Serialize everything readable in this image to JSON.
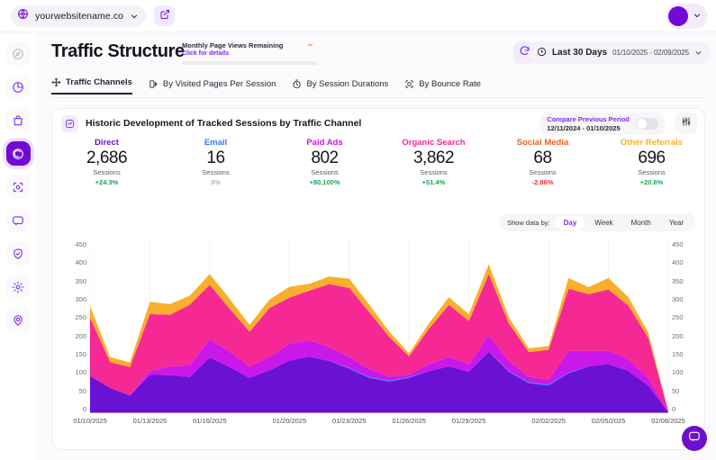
{
  "topbar": {
    "site_name": "yourwebsitename.co",
    "globe_icon": "globe-icon",
    "chevron_icon": "chevron-down-icon",
    "share_icon": "external-link-icon",
    "avatar_icon": "avatar",
    "avatar_chevron": "chevron-down-icon"
  },
  "sidebar": {
    "items": [
      {
        "name": "sidebar-item-dashboard",
        "icon": "compass-icon",
        "active": false,
        "muted": true
      },
      {
        "name": "sidebar-item-analytics",
        "icon": "pie-chart-icon",
        "active": false,
        "muted": false
      },
      {
        "name": "sidebar-item-ecommerce",
        "icon": "bag-icon",
        "active": false,
        "muted": false
      },
      {
        "name": "sidebar-item-traffic",
        "icon": "traffic-spiral-icon",
        "active": true,
        "muted": false
      },
      {
        "name": "sidebar-item-audience",
        "icon": "target-icon",
        "active": false,
        "muted": false
      },
      {
        "name": "sidebar-item-messages",
        "icon": "chat-icon",
        "active": false,
        "muted": false
      },
      {
        "name": "sidebar-item-privacy",
        "icon": "shield-icon",
        "active": false,
        "muted": false
      },
      {
        "name": "sidebar-item-settings",
        "icon": "gear-icon",
        "active": false,
        "muted": false
      },
      {
        "name": "sidebar-item-account",
        "icon": "user-pin-icon",
        "active": false,
        "muted": false
      }
    ]
  },
  "header": {
    "title": "Traffic Structure",
    "quota_title": "Monthly Page Views Remaining",
    "quota_link": "Click for details",
    "quota_value": "∞",
    "quota_percent": 0,
    "refresh_icon": "refresh-icon",
    "clock_icon": "clock-icon",
    "range_label": "Last 30 Days",
    "range_dates": "01/10/2025 - 02/09/2025",
    "range_chevron": "chevron-down-icon"
  },
  "tabs": [
    {
      "label": "Traffic Channels",
      "icon": "share-nodes-icon",
      "active": true
    },
    {
      "label": "By Visited Pages Per Session",
      "icon": "pages-icon",
      "active": false
    },
    {
      "label": "By Session Durations",
      "icon": "stopwatch-icon",
      "active": false
    },
    {
      "label": "By Bounce Rate",
      "icon": "bounce-icon",
      "active": false
    }
  ],
  "card": {
    "badge_icon": "chart-badge-icon",
    "title": "Historic Development of Tracked Sessions by Traffic Channel",
    "compare_label": "Compare Previous Period",
    "compare_dates": "12/11/2024 - 01/10/2025",
    "compare_enabled": false,
    "filter_icon": "sliders-icon"
  },
  "metrics": [
    {
      "label": "Direct",
      "value": "2,686",
      "unit": "Sessions",
      "delta": "+24.3%",
      "color": "#6B11D4",
      "delta_color": "#1aa45a"
    },
    {
      "label": "Email",
      "value": "16",
      "unit": "Sessions",
      "delta": "0%",
      "color": "#2F7BF6",
      "delta_color": "#b6b5bd"
    },
    {
      "label": "Paid Ads",
      "value": "802",
      "unit": "Sessions",
      "delta": "+80,100%",
      "color": "#C918E8",
      "delta_color": "#1aa45a"
    },
    {
      "label": "Organic Search",
      "value": "3,862",
      "unit": "Sessions",
      "delta": "+51.4%",
      "color": "#F52894",
      "delta_color": "#1aa45a"
    },
    {
      "label": "Social Media",
      "value": "68",
      "unit": "Sessions",
      "delta": "-2.86%",
      "color": "#F2601C",
      "delta_color": "#e8312a"
    },
    {
      "label": "Other Referrals",
      "value": "696",
      "unit": "Sessions",
      "delta": "+20.6%",
      "color": "#F9AF2B",
      "delta_color": "#1aa45a"
    }
  ],
  "show_data_by": {
    "label": "Show data by:",
    "options": [
      "Day",
      "Week",
      "Month",
      "Year"
    ],
    "selected": "Day"
  },
  "chat": {
    "icon": "chat-bubble-icon"
  },
  "chart_data": {
    "type": "area",
    "stacked": true,
    "title": "Historic Development of Tracked Sessions by Traffic Channel",
    "xlabel": "",
    "ylabel": "",
    "ylim": [
      0,
      450
    ],
    "yticks": [
      450,
      400,
      350,
      300,
      250,
      200,
      150,
      100,
      50,
      0
    ],
    "grid": "vertical-only",
    "legend": "top-metrics",
    "x": [
      "01/10/2025",
      "01/11/2025",
      "01/12/2025",
      "01/13/2025",
      "01/14/2025",
      "01/15/2025",
      "01/16/2025",
      "01/17/2025",
      "01/18/2025",
      "01/19/2025",
      "01/20/2025",
      "01/21/2025",
      "01/22/2025",
      "01/23/2025",
      "01/24/2025",
      "01/25/2025",
      "01/26/2025",
      "01/27/2025",
      "01/28/2025",
      "01/29/2025",
      "01/30/2025",
      "01/31/2025",
      "02/01/2025",
      "02/02/2025",
      "02/03/2025",
      "02/04/2025",
      "02/05/2025",
      "02/06/2025",
      "02/07/2025",
      "02/08/2025"
    ],
    "xticks": [
      "01/10/2025",
      "01/13/2025",
      "01/16/2025",
      "01/20/2025",
      "01/23/2025",
      "01/26/2025",
      "01/29/2025",
      "02/02/2025",
      "02/05/2025",
      "02/08/2025"
    ],
    "series": [
      {
        "name": "Direct",
        "color": "#6B11D4",
        "values": [
          97,
          66,
          46,
          100,
          99,
          94,
          145,
          120,
          92,
          112,
          137,
          147,
          136,
          116,
          92,
          82,
          92,
          110,
          122,
          108,
          160,
          108,
          78,
          72,
          104,
          122,
          128,
          110,
          72,
          2
        ]
      },
      {
        "name": "Email",
        "color": "#2F7BF6",
        "values": [
          0,
          0,
          0,
          0,
          0,
          0,
          0,
          0,
          0,
          0,
          0,
          0,
          0,
          2,
          3,
          3,
          2,
          0,
          0,
          0,
          0,
          2,
          3,
          3,
          2,
          0,
          0,
          0,
          0,
          0
        ]
      },
      {
        "name": "Paid Ads",
        "color": "#C918E8",
        "values": [
          0,
          0,
          0,
          10,
          22,
          31,
          47,
          40,
          30,
          34,
          44,
          42,
          36,
          28,
          20,
          10,
          6,
          18,
          24,
          20,
          42,
          26,
          14,
          12,
          56,
          40,
          34,
          30,
          20,
          1
        ]
      },
      {
        "name": "Organic Search",
        "color": "#F52894",
        "values": [
          152,
          67,
          74,
          148,
          135,
          157,
          142,
          112,
          90,
          128,
          120,
          130,
          164,
          180,
          148,
          104,
          48,
          92,
          136,
          112,
          160,
          98,
          64,
          78,
          162,
          148,
          160,
          140,
          104,
          3
        ]
      },
      {
        "name": "Other Referrals",
        "color": "#F9AF2B",
        "values": [
          30,
          13,
          12,
          32,
          28,
          24,
          28,
          26,
          18,
          22,
          28,
          18,
          20,
          24,
          20,
          14,
          8,
          14,
          20,
          18,
          26,
          16,
          10,
          10,
          28,
          18,
          30,
          22,
          14,
          0
        ]
      }
    ]
  }
}
